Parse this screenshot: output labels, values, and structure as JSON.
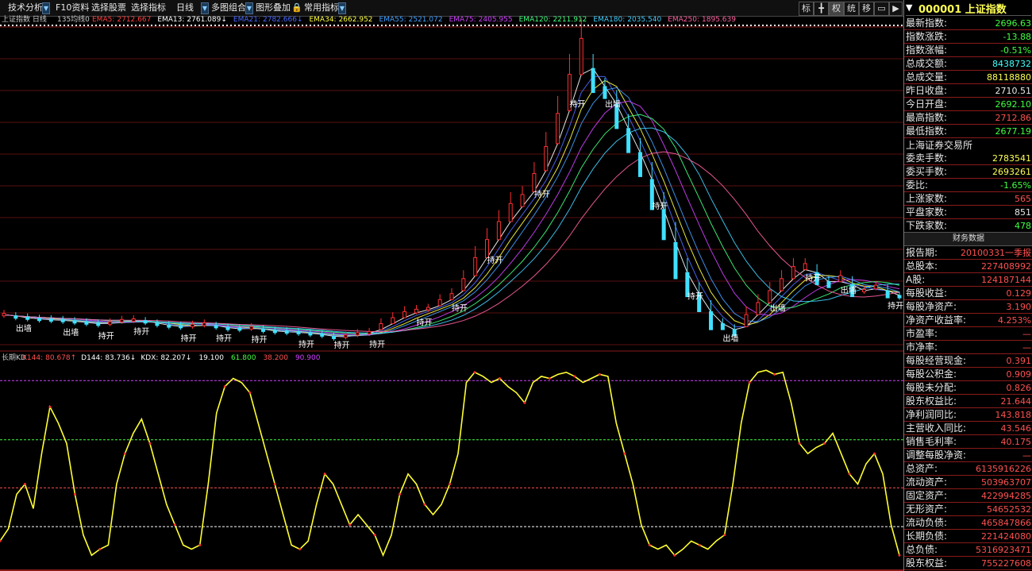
{
  "toolbar": {
    "items": [
      {
        "label": "技术分析"
      },
      {
        "label": "F10资料"
      },
      {
        "label": "选择股票"
      },
      {
        "label": "选择指标"
      },
      {
        "label": "日线"
      },
      {
        "label": "多图组合"
      },
      {
        "label": "图形叠加"
      },
      {
        "label": "常用指标"
      }
    ],
    "right_buttons": [
      "标",
      "",
      "权",
      "统",
      "移",
      "",
      ""
    ]
  },
  "main_chart": {
    "title": "上证指数 日线",
    "indicator": "135均线0",
    "ema": [
      {
        "name": "EMA5:",
        "value": "2712.667",
        "color": "#ff4040"
      },
      {
        "name": "EMA13:",
        "value": "2761.089↓",
        "color": "#ffffff"
      },
      {
        "name": "EMA21:",
        "value": "2782.666↓",
        "color": "#4a6aff"
      },
      {
        "name": "EMA34:",
        "value": "2662.952",
        "color": "#ffff40"
      },
      {
        "name": "EMA55:",
        "value": "2521.072",
        "color": "#40a0ff"
      },
      {
        "name": "EMA75:",
        "value": "2405.955",
        "color": "#d040ff"
      },
      {
        "name": "EMA120:",
        "value": "2211.912",
        "color": "#40ff80"
      },
      {
        "name": "EMA180:",
        "value": "2035.540",
        "color": "#40d0ff"
      },
      {
        "name": "EMA250:",
        "value": "1895.639",
        "color": "#ff60a0"
      }
    ],
    "signals": [
      {
        "text": "出墙"
      },
      {
        "text": "出墙"
      },
      {
        "text": "持开"
      },
      {
        "text": "持开"
      },
      {
        "text": "持开"
      },
      {
        "text": "持开"
      },
      {
        "text": "持开"
      },
      {
        "text": "持开"
      },
      {
        "text": "持开"
      },
      {
        "text": "持开"
      },
      {
        "text": "持开"
      },
      {
        "text": "持开"
      },
      {
        "text": "持开"
      },
      {
        "text": "持开"
      },
      {
        "text": "持开"
      },
      {
        "text": "出墙"
      },
      {
        "text": "持开"
      },
      {
        "text": "持开"
      },
      {
        "text": "出墙"
      },
      {
        "text": "出墙"
      },
      {
        "text": "持开"
      },
      {
        "text": "出墙"
      },
      {
        "text": "持开"
      }
    ]
  },
  "kd_chart": {
    "title": "长期KD",
    "values": [
      {
        "name": "K144:",
        "value": "80.678↑",
        "color": "#ff5050"
      },
      {
        "name": "D144:",
        "value": "83.736↓",
        "color": "#ffffff"
      },
      {
        "name": "KDX:",
        "value": "82.207↓",
        "color": "#ffffff"
      },
      {
        "name": "",
        "value": "19.100",
        "color": "#ffffff"
      },
      {
        "name": "",
        "value": "61.800",
        "color": "#40ff40"
      },
      {
        "name": "",
        "value": "38.200",
        "color": "#ff5050"
      },
      {
        "name": "",
        "value": "90.900",
        "color": "#d040ff"
      }
    ]
  },
  "kd_series": [
    12,
    18,
    35,
    40,
    28,
    55,
    78,
    70,
    60,
    35,
    15,
    5,
    8,
    10,
    40,
    55,
    65,
    72,
    60,
    45,
    30,
    20,
    10,
    8,
    10,
    40,
    75,
    88,
    92,
    90,
    85,
    70,
    55,
    40,
    25,
    10,
    8,
    12,
    30,
    45,
    40,
    30,
    20,
    25,
    20,
    15,
    5,
    15,
    35,
    45,
    40,
    30,
    25,
    30,
    40,
    55,
    90,
    95,
    93,
    90,
    92,
    88,
    85,
    80,
    90,
    93,
    92,
    94,
    95,
    93,
    90,
    92,
    94,
    93,
    70,
    55,
    40,
    20,
    10,
    8,
    10,
    5,
    8,
    12,
    10,
    8,
    12,
    15,
    40,
    70,
    90,
    95,
    96,
    94,
    95,
    80,
    60,
    55,
    58,
    60,
    65,
    55,
    45,
    40,
    50,
    55,
    45,
    20,
    5
  ],
  "price_series": [
    2950,
    2930,
    2920,
    2910,
    2905,
    2900,
    2890,
    2880,
    2870,
    2880,
    2900,
    2905,
    2890,
    2870,
    2855,
    2850,
    2860,
    2870,
    2850,
    2835,
    2830,
    2840,
    2820,
    2810,
    2805,
    2800,
    2790,
    2780,
    2760,
    2770,
    2790,
    2800,
    2850,
    2900,
    2950,
    2980,
    3000,
    3050,
    3100,
    3200,
    3350,
    3500,
    3650,
    3800,
    3900,
    4050,
    4250,
    4500,
    4800,
    5100,
    4900,
    4800,
    4600,
    4400,
    4200,
    3950,
    3700,
    3400,
    3200,
    3050,
    2900,
    2850,
    2800,
    2900,
    3000,
    3100,
    3200,
    3300,
    3350,
    3250,
    3200,
    3250,
    3150,
    3150,
    3180,
    3120,
    3100
  ],
  "panel": {
    "code": "000001 上证指数",
    "quote": [
      {
        "k": "最新指数:",
        "v": "2696.63",
        "c": "#40ff40"
      },
      {
        "k": "指数涨跌:",
        "v": "-13.88",
        "c": "#40ff40"
      },
      {
        "k": "指数涨幅:",
        "v": "-0.51%",
        "c": "#40ff40"
      },
      {
        "k": "总成交额:",
        "v": "8438732",
        "c": "#40ffff"
      },
      {
        "k": "总成交量:",
        "v": "88118880",
        "c": "#ffff55"
      },
      {
        "k": "昨日收盘:",
        "v": "2710.51",
        "c": "#e8e8e8"
      },
      {
        "k": "今日开盘:",
        "v": "2692.10",
        "c": "#40ff40"
      },
      {
        "k": "最高指数:",
        "v": "2712.86",
        "c": "#ff5050"
      },
      {
        "k": "最低指数:",
        "v": "2677.19",
        "c": "#40ff40"
      }
    ],
    "exchange": "上海证券交易所",
    "orders": [
      {
        "k": "委卖手数:",
        "v": "2783541",
        "c": "#ffff55"
      },
      {
        "k": "委买手数:",
        "v": "2693261",
        "c": "#ffff55"
      },
      {
        "k": "委比:",
        "v": "-1.65%",
        "c": "#40ff40"
      },
      {
        "k": "上涨家数:",
        "v": "565",
        "c": "#ff5050"
      },
      {
        "k": "平盘家数:",
        "v": "851",
        "c": "#e8e8e8"
      },
      {
        "k": "下跌家数:",
        "v": "478",
        "c": "#40ff40"
      }
    ],
    "fin_title": "财务数据",
    "finance": [
      {
        "k": "报告期:",
        "v": "20100331一季报",
        "c": "#ff5050"
      },
      {
        "k": "总股本:",
        "v": "227408992",
        "c": "#ff5050"
      },
      {
        "k": "A股:",
        "v": "124187144",
        "c": "#ff5050"
      },
      {
        "k": "每股收益:",
        "v": "0.129",
        "c": "#ff5050"
      },
      {
        "k": "每股净资产:",
        "v": "3.190",
        "c": "#ff5050"
      },
      {
        "k": "净资产收益率:",
        "v": "4.253%",
        "c": "#ff5050"
      },
      {
        "k": "市盈率:",
        "v": "—",
        "c": "#ff5050"
      },
      {
        "k": "市净率:",
        "v": "—",
        "c": "#ff5050"
      },
      {
        "k": "每股经营现金:",
        "v": "0.391",
        "c": "#ff5050"
      },
      {
        "k": "每股公积金:",
        "v": "0.909",
        "c": "#ff5050"
      },
      {
        "k": "每股未分配:",
        "v": "0.826",
        "c": "#ff5050"
      },
      {
        "k": "股东权益比:",
        "v": "21.644",
        "c": "#ff5050"
      },
      {
        "k": "净利润同比:",
        "v": "143.818",
        "c": "#ff5050"
      },
      {
        "k": "主营收入同比:",
        "v": "43.546",
        "c": "#ff5050"
      },
      {
        "k": "销售毛利率:",
        "v": "40.175",
        "c": "#ff5050"
      },
      {
        "k": "调整每股净资:",
        "v": "—",
        "c": "#ff5050"
      },
      {
        "k": "总资产:",
        "v": "6135916226",
        "c": "#ff5050"
      },
      {
        "k": "流动资产:",
        "v": "503963707",
        "c": "#ff5050"
      },
      {
        "k": "固定资产:",
        "v": "422994285",
        "c": "#ff5050"
      },
      {
        "k": "无形资产:",
        "v": "54652532",
        "c": "#ff5050"
      },
      {
        "k": "流动负债:",
        "v": "465847866",
        "c": "#ff5050"
      },
      {
        "k": "长期负债:",
        "v": "221424080",
        "c": "#ff5050"
      },
      {
        "k": "总负债:",
        "v": "5316923471",
        "c": "#ff5050"
      },
      {
        "k": "股东权益:",
        "v": "755227608",
        "c": "#ff5050"
      }
    ]
  }
}
